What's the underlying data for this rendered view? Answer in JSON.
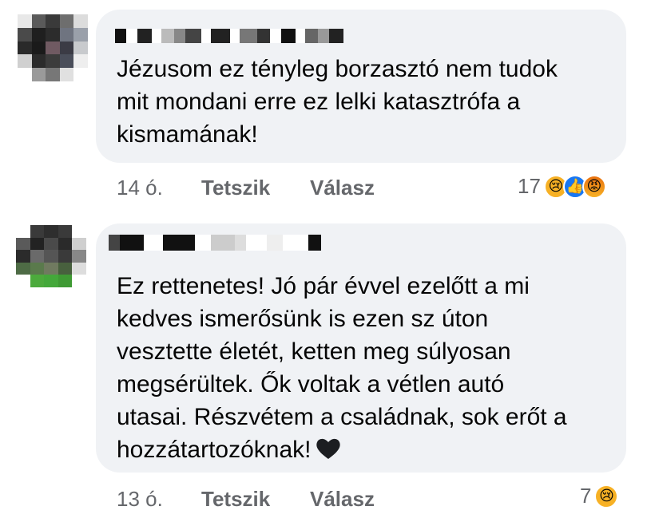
{
  "comments": [
    {
      "text": "Jézusom ez tényleg borzasztó nem tudok\nmit mondani erre ez lelki katasztrófa a\nkismamának!",
      "time": "14 ó.",
      "like_label": "Tetszik",
      "reply_label": "Válasz",
      "reaction_count": "17",
      "reactions": [
        "sad-react-icon",
        "like-react-icon",
        "angry-react-icon"
      ]
    },
    {
      "text": "Ez rettenetes! Jó pár évvel ezelőtt a mi\nkedves ismerősünk is ezen sz úton\nvesztette életét, ketten meg súlyosan\nmegsérültek. Ők voltak a vétlen autó\nutasai. Részvétem a családnak, sok erőt a\nhozzátartozóknak!",
      "time": "13 ó.",
      "like_label": "Tetszik",
      "reply_label": "Válasz",
      "reaction_count": "7",
      "reactions": [
        "sad-react-icon"
      ]
    }
  ],
  "colors": {
    "bubble": "#f0f2f5",
    "meta_text": "#65676b",
    "body_text": "#050505"
  }
}
